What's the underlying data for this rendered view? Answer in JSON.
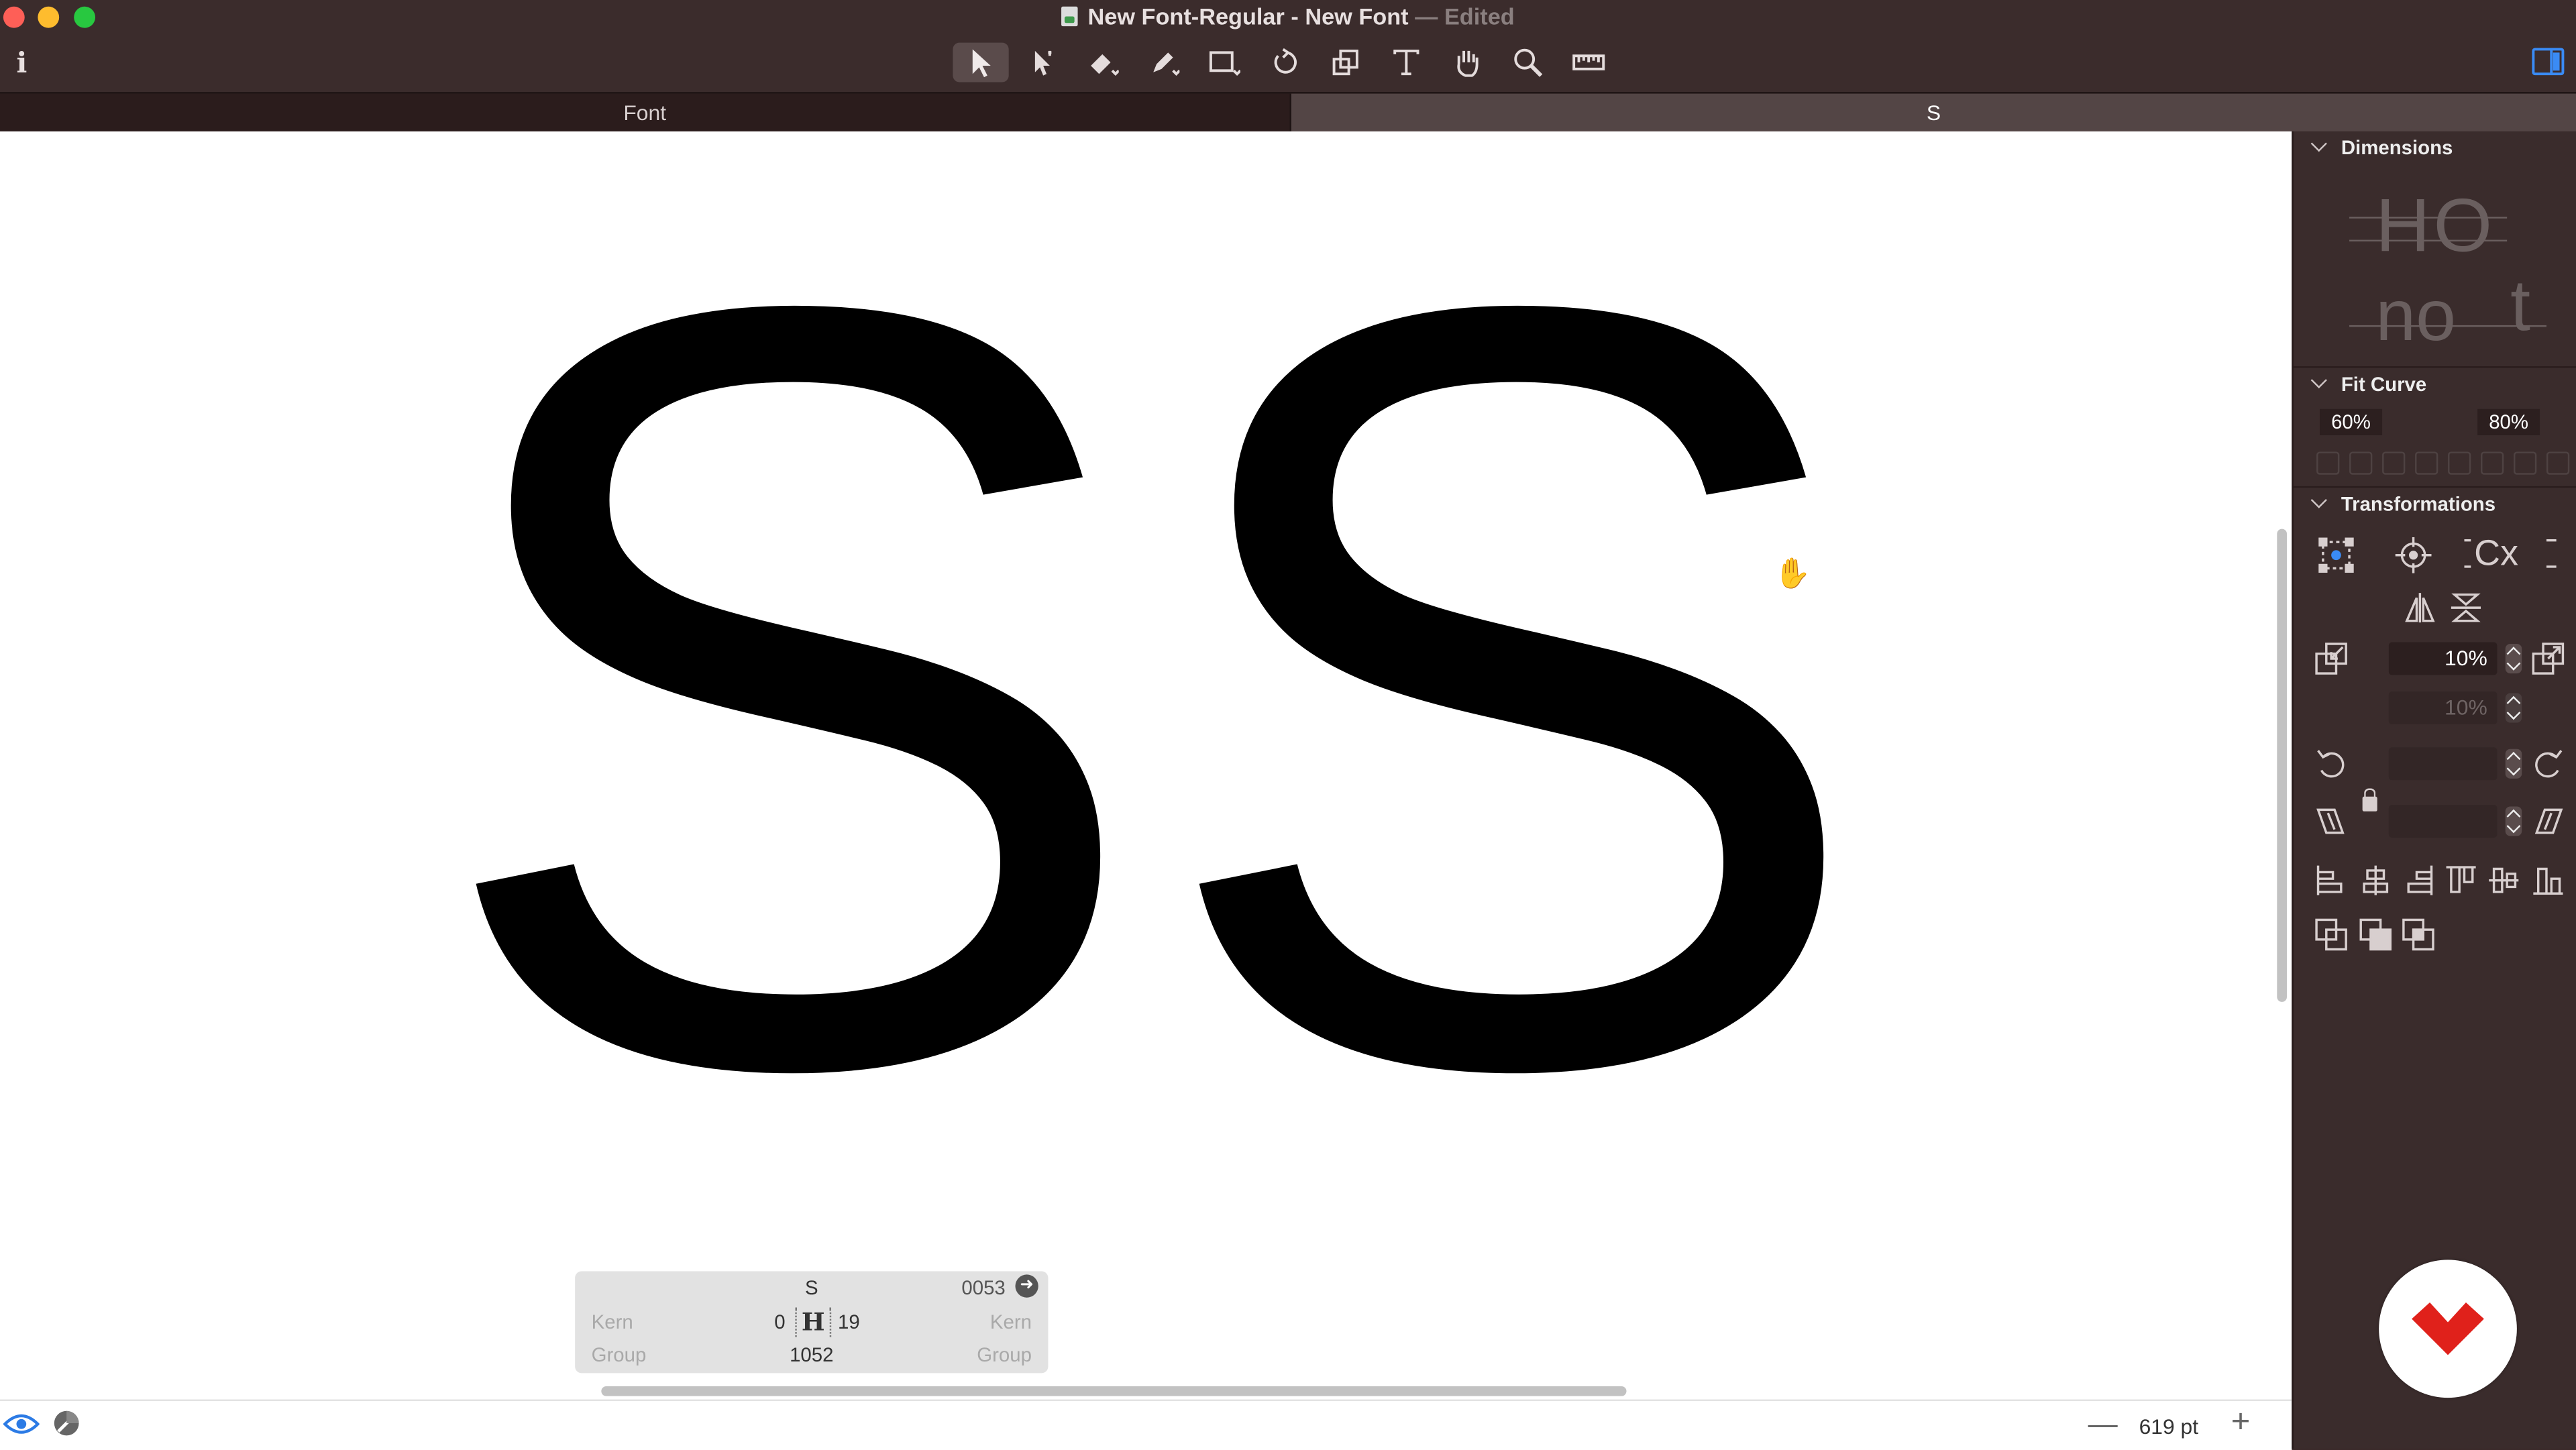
{
  "window": {
    "title": "New Font-Regular - New Font",
    "title_separator": "—",
    "status": "Edited",
    "info_label": "i"
  },
  "toolbar": {
    "tools": [
      {
        "name": "select-tool-icon",
        "active": true
      },
      {
        "name": "select-all-layers-tool-icon",
        "active": false
      },
      {
        "name": "eraser-tool-icon",
        "active": false
      },
      {
        "name": "pencil-tool-icon",
        "active": false
      },
      {
        "name": "rectangle-tool-icon",
        "active": false
      },
      {
        "name": "rotate-tool-icon",
        "active": false
      },
      {
        "name": "scale-tool-icon",
        "active": false
      },
      {
        "name": "text-tool-icon",
        "active": false
      },
      {
        "name": "hand-tool-icon",
        "active": false
      },
      {
        "name": "zoom-tool-icon",
        "active": false
      },
      {
        "name": "measure-tool-icon",
        "active": false
      }
    ]
  },
  "tabs": [
    {
      "label": "Font",
      "active": false
    },
    {
      "label": "S",
      "active": true
    }
  ],
  "canvas": {
    "glyph_text": "SS"
  },
  "glyph_info": {
    "glyph_name": "S",
    "unicode": "0053",
    "kern_label_left": "Kern",
    "kern_value_left": "0",
    "kern_value_right": "19",
    "kern_label_right": "Kern",
    "group_label_left": "Group",
    "group_value": "1052",
    "group_label_right": "Group"
  },
  "statusbar": {
    "zoom_minus": "—",
    "zoom_value": "619 pt",
    "zoom_plus": "+"
  },
  "inspector": {
    "dimensions": {
      "title": "Dimensions",
      "preview_1": "HO",
      "preview_2": "no",
      "preview_3": "t"
    },
    "fit_curve": {
      "title": "Fit Curve",
      "min": "60%",
      "max": "80%"
    },
    "transformations": {
      "title": "Transformations",
      "scale_x": "10%",
      "scale_y": "10%",
      "rotate": "",
      "slant": ""
    }
  },
  "colors": {
    "titlebar": "#3b2c2c",
    "tab_active": "#534545",
    "tab_inactive": "#2b1c1c",
    "accent": "#3a8bf5",
    "brand_red": "#e0211b"
  }
}
